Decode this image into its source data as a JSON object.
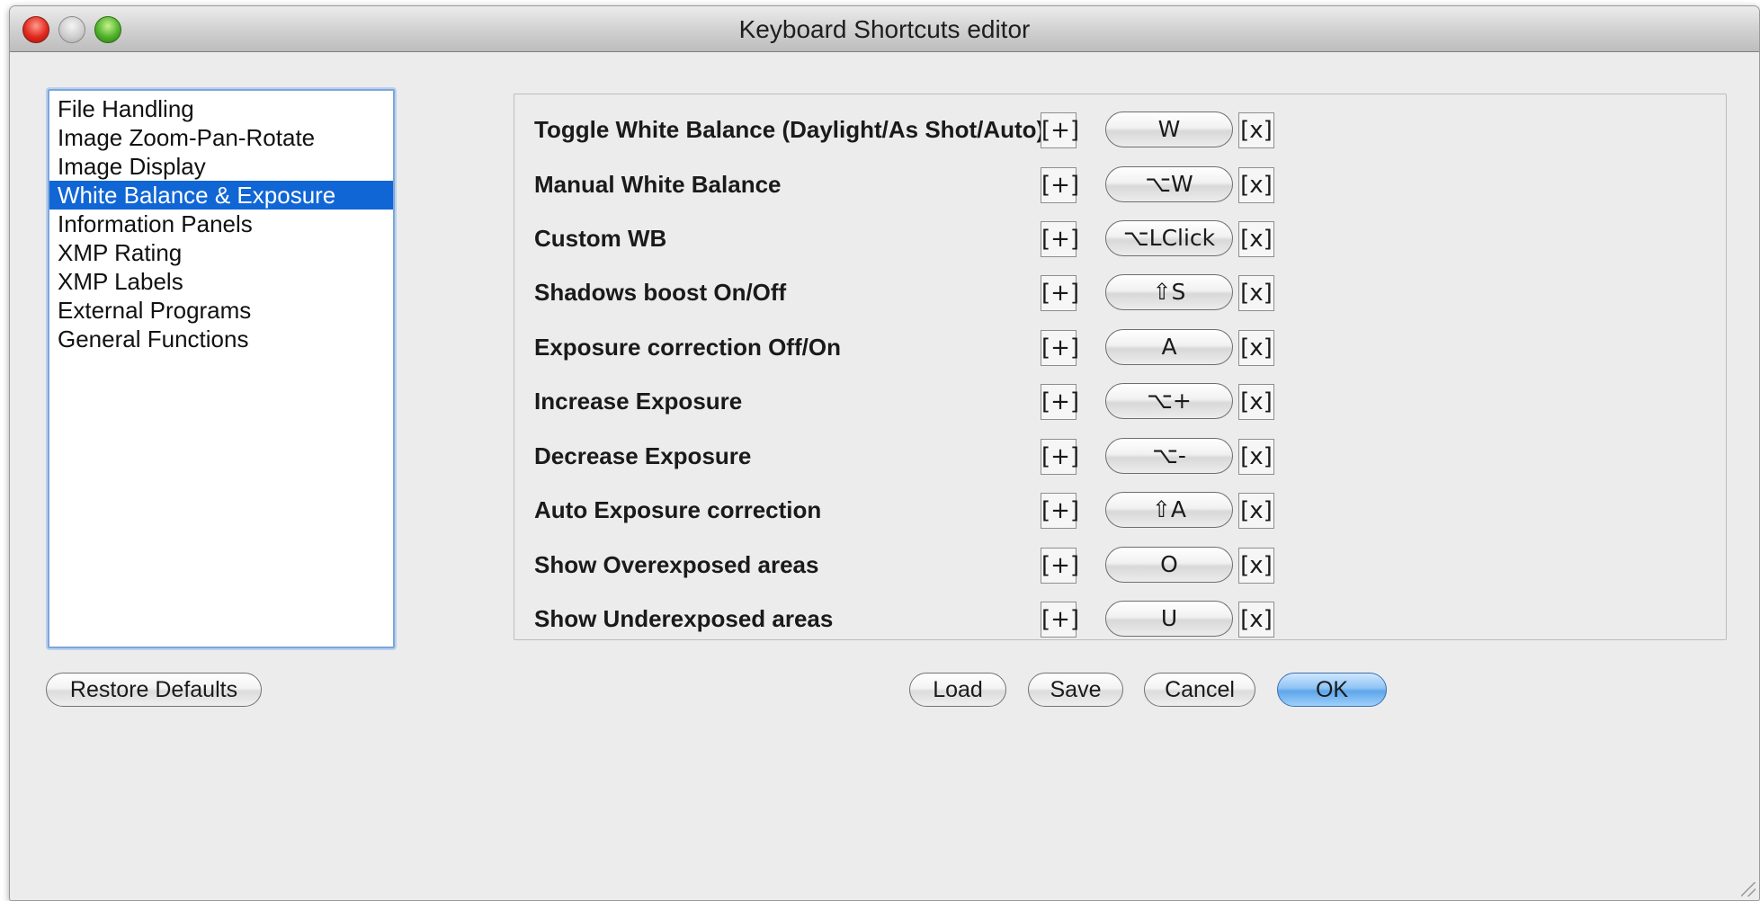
{
  "window": {
    "title": "Keyboard Shortcuts editor"
  },
  "categories": [
    {
      "label": "File Handling",
      "selected": false
    },
    {
      "label": "Image Zoom-Pan-Rotate",
      "selected": false
    },
    {
      "label": "Image Display",
      "selected": false
    },
    {
      "label": "White Balance & Exposure",
      "selected": true
    },
    {
      "label": "Information Panels",
      "selected": false
    },
    {
      "label": "XMP Rating",
      "selected": false
    },
    {
      "label": "XMP Labels",
      "selected": false
    },
    {
      "label": "External Programs",
      "selected": false
    },
    {
      "label": "General Functions",
      "selected": false
    }
  ],
  "shortcut_controls": {
    "add_label": "[+]",
    "remove_label": "[x]"
  },
  "shortcuts": [
    {
      "label": "Toggle White Balance (Daylight/As Shot/Auto)",
      "key": "W"
    },
    {
      "label": "Manual White Balance",
      "key": "⌥W"
    },
    {
      "label": "Custom WB",
      "key": "⌥LClick"
    },
    {
      "label": "Shadows boost On/Off",
      "key": "⇧S"
    },
    {
      "label": "Exposure correction Off/On",
      "key": "A"
    },
    {
      "label": "Increase Exposure",
      "key": "⌥+"
    },
    {
      "label": "Decrease Exposure",
      "key": "⌥-"
    },
    {
      "label": "Auto Exposure correction",
      "key": "⇧A"
    },
    {
      "label": "Show Overexposed areas",
      "key": "O"
    },
    {
      "label": "Show Underexposed areas",
      "key": "U"
    }
  ],
  "footer": {
    "restore_label": "Restore Defaults",
    "load_label": "Load",
    "save_label": "Save",
    "cancel_label": "Cancel",
    "ok_label": "OK"
  },
  "colors": {
    "selection": "#1166d6",
    "default_button": "#5ea6ea",
    "window_bg": "#ececec"
  }
}
